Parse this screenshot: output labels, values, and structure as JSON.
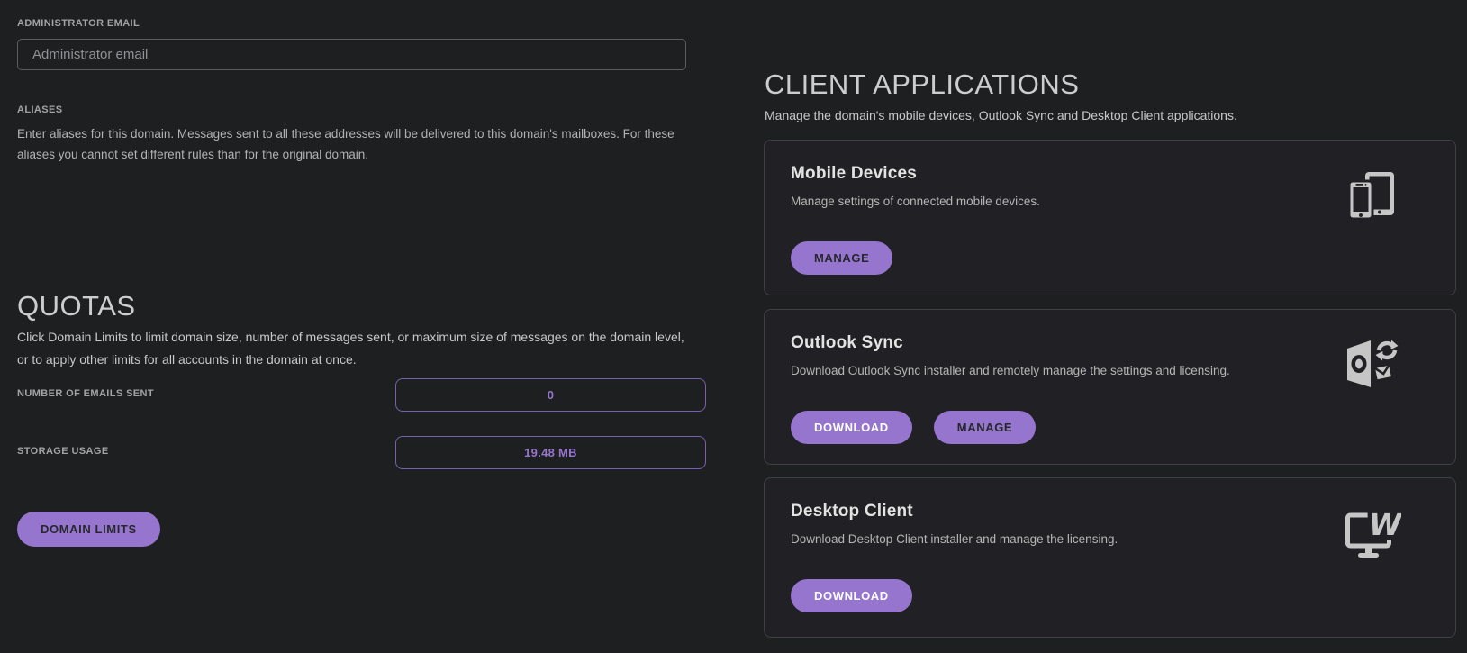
{
  "theme": {
    "page_background": "#1e1f21",
    "card_background": "#212125",
    "card_border": "#3e4045",
    "accent_purple": "#9575cd",
    "quota_field_border": "#7661ad",
    "icon_gray": "#c6c6c6",
    "heading_color": "#cdcdcd",
    "body_text_color": "#b2b2b2"
  },
  "left": {
    "admin_email": {
      "label": "ADMINISTRATOR EMAIL",
      "placeholder": "Administrator email",
      "value": ""
    },
    "aliases": {
      "label": "ALIASES",
      "description": "Enter aliases for this domain. Messages sent to all these addresses will be delivered to this domain's mailboxes. For these aliases you cannot set different rules than for the original domain."
    },
    "quotas": {
      "title": "QUOTAS",
      "description": "Click Domain Limits to limit domain size, number of messages sent, or maximum size of messages on the domain level, or to apply other limits for all accounts in the domain at once.",
      "rows": [
        {
          "label": "NUMBER OF EMAILS SENT",
          "value": "0"
        },
        {
          "label": "STORAGE USAGE",
          "value": "19.48 MB"
        }
      ],
      "button_label": "DOMAIN LIMITS"
    }
  },
  "right": {
    "title": "CLIENT APPLICATIONS",
    "subtitle": "Manage the domain's mobile devices, Outlook Sync and Desktop Client applications.",
    "cards": [
      {
        "title": "Mobile Devices",
        "description": "Manage settings of connected mobile devices.",
        "icon": "mobile-devices-icon",
        "buttons": [
          {
            "label": "MANAGE",
            "variant": "secondary"
          }
        ]
      },
      {
        "title": "Outlook Sync",
        "description": "Download Outlook Sync installer and remotely manage the settings and licensing.",
        "icon": "outlook-sync-icon",
        "buttons": [
          {
            "label": "DOWNLOAD",
            "variant": "primary"
          },
          {
            "label": "MANAGE",
            "variant": "secondary"
          }
        ]
      },
      {
        "title": "Desktop Client",
        "description": "Download Desktop Client installer and manage the licensing.",
        "icon": "desktop-client-icon",
        "buttons": [
          {
            "label": "DOWNLOAD",
            "variant": "primary"
          }
        ]
      }
    ]
  }
}
